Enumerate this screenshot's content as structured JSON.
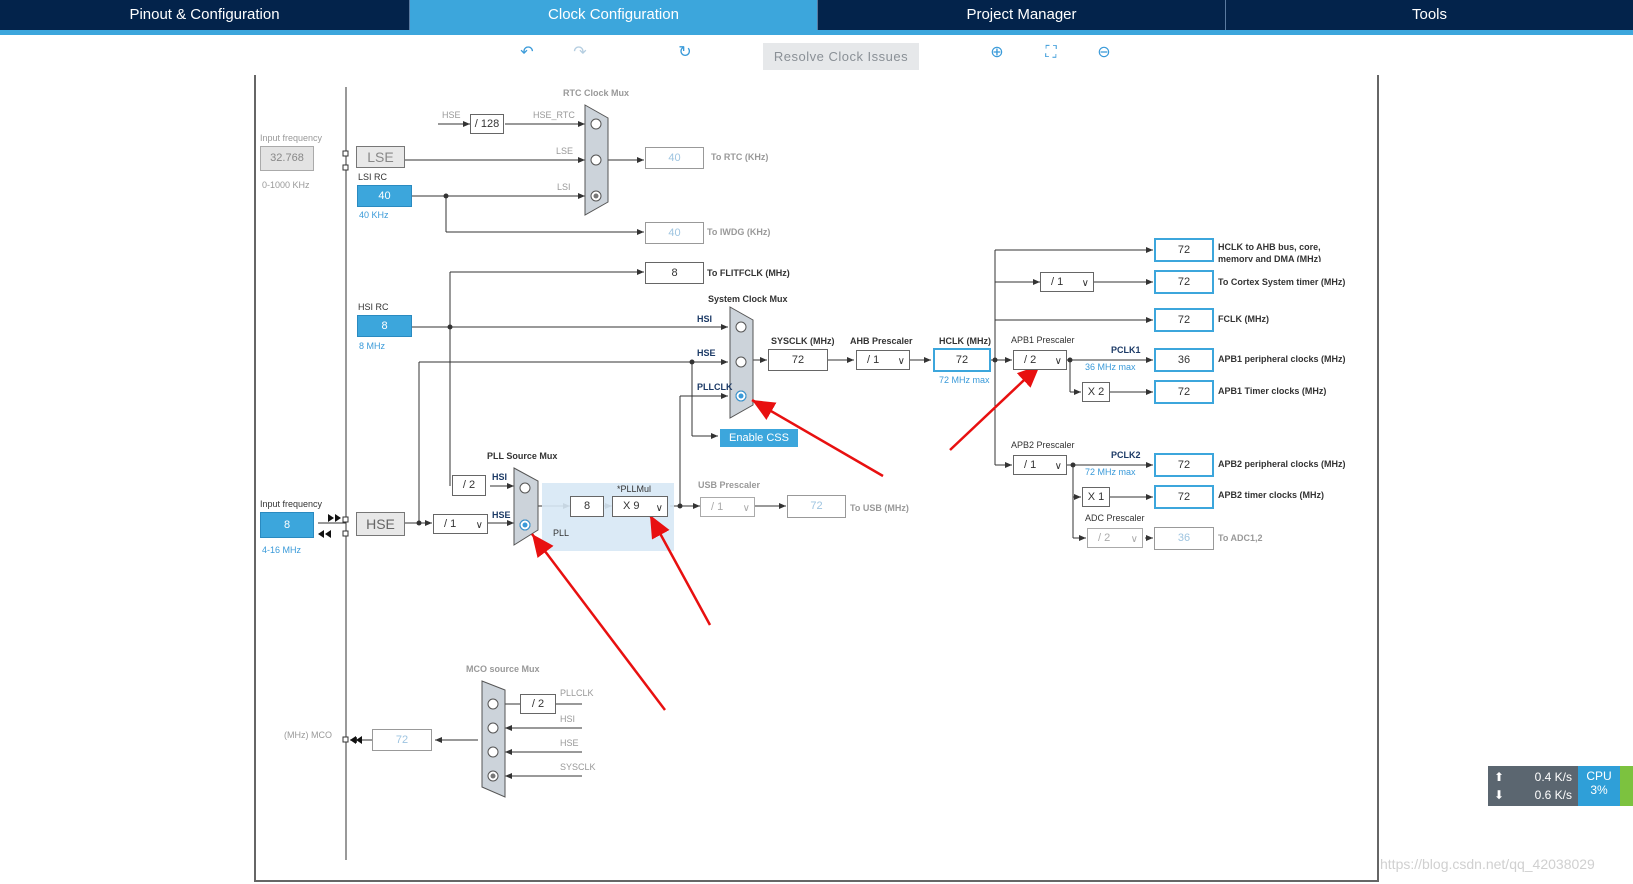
{
  "tabs": [
    "Pinout & Configuration",
    "Clock Configuration",
    "Project Manager",
    "Tools"
  ],
  "toolbar": {
    "resolve_label": "Resolve Clock Issues"
  },
  "rtc_mux": {
    "title": "RTC Clock Mux",
    "hse_label": "HSE",
    "div128": "/ 128",
    "hse_rtc": "HSE_RTC",
    "lse_label": "LSE",
    "lsi_label": "LSI",
    "out_value": "40",
    "out_label": "To RTC (KHz)"
  },
  "lse": {
    "input_label": "Input frequency",
    "value": "32.768",
    "range": "0-1000 KHz",
    "name": "LSE"
  },
  "lsi": {
    "name": "LSI RC",
    "value": "40",
    "unit": "40 KHz"
  },
  "iwdg": {
    "value": "40",
    "label": "To IWDG (KHz)"
  },
  "flitf": {
    "value": "8",
    "label": "To FLITFCLK (MHz)"
  },
  "hsi": {
    "name": "HSI RC",
    "value": "8",
    "unit": "8 MHz"
  },
  "sys_mux": {
    "title": "System Clock Mux",
    "hsi": "HSI",
    "hse": "HSE",
    "pllclk": "PLLCLK"
  },
  "sysclk": {
    "label": "SYSCLK (MHz)",
    "value": "72"
  },
  "ahb": {
    "label": "AHB Prescaler",
    "value": "/ 1"
  },
  "hclk": {
    "label": "HCLK (MHz)",
    "value": "72",
    "max": "72 MHz max"
  },
  "css_label": "Enable CSS",
  "pll_mux": {
    "title": "PLL Source Mux",
    "hsi": "HSI",
    "hse": "HSE",
    "div2": "/ 2"
  },
  "pll": {
    "value": "8",
    "mul_label": "*PLLMul",
    "mul": "X 9",
    "name": "PLL"
  },
  "usb": {
    "label": "USB Prescaler",
    "value": "/ 1",
    "out": "72",
    "out_label": "To USB (MHz)"
  },
  "hse": {
    "input_label": "Input frequency",
    "value": "8",
    "range": "4-16 MHz",
    "name": "HSE",
    "div": "/ 1"
  },
  "outputs": {
    "hclk_ahb": {
      "value": "72",
      "label1": "HCLK to AHB bus, core,",
      "label2": "memory and DMA (MHz)"
    },
    "cortex": {
      "div": "/ 1",
      "value": "72",
      "label": "To Cortex System timer (MHz)"
    },
    "fclk": {
      "value": "72",
      "label": "FCLK (MHz)"
    },
    "apb1": {
      "prescaler_label": "APB1 Prescaler",
      "div": "/ 2",
      "pclk": "PCLK1",
      "max": "36 MHz max",
      "value": "36",
      "label": "APB1 peripheral clocks (MHz)",
      "mult": "X 2",
      "timer_value": "72",
      "timer_label": "APB1 Timer clocks (MHz)"
    },
    "apb2": {
      "prescaler_label": "APB2 Prescaler",
      "div": "/ 1",
      "pclk": "PCLK2",
      "max": "72 MHz max",
      "value": "72",
      "label": "APB2 peripheral clocks (MHz)",
      "mult": "X 1",
      "timer_value": "72",
      "timer_label": "APB2 timer clocks (MHz)"
    },
    "adc": {
      "prescaler_label": "ADC Prescaler",
      "div": "/ 2",
      "value": "36",
      "label": "To ADC1,2"
    }
  },
  "mco": {
    "title": "MCO source Mux",
    "div2": "/ 2",
    "pllclk": "PLLCLK",
    "hsi": "HSI",
    "hse": "HSE",
    "sysclk": "SYSCLK",
    "out_value": "72",
    "out_label": "(MHz) MCO"
  },
  "net_monitor": {
    "up": "0.4 K/s",
    "down": "0.6 K/s",
    "cpu_label": "CPU",
    "cpu_value": "3%"
  },
  "watermark": "https://blog.csdn.net/qq_42038029"
}
